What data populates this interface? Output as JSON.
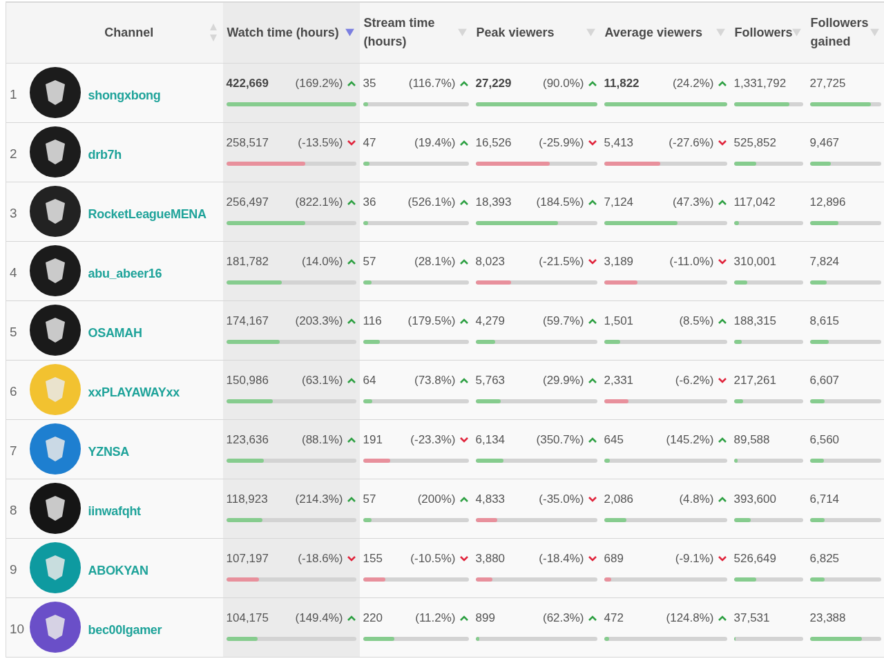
{
  "columns": [
    {
      "label": "Channel",
      "kind": "both",
      "selected": false
    },
    {
      "label": "Watch time (hours)",
      "kind": "desc",
      "selected": true
    },
    {
      "label": "Stream time (hours)",
      "kind": "desc",
      "selected": false
    },
    {
      "label": "Peak viewers",
      "kind": "desc",
      "selected": false
    },
    {
      "label": "Average viewers",
      "kind": "desc",
      "selected": false
    },
    {
      "label": "Followers",
      "kind": "desc",
      "selected": false
    },
    {
      "label": "Followers gained",
      "kind": "desc",
      "selected": false
    }
  ],
  "rows": [
    {
      "rank": "1",
      "name": "shongxbong",
      "color": "#1c1c1c",
      "metrics": [
        {
          "value": "422,669",
          "change": "(169.2%)",
          "rising": true,
          "bold": true,
          "level": 1
        },
        {
          "value": "35",
          "change": "(116.7%)",
          "rising": true,
          "bold": false,
          "level": 0.05
        },
        {
          "value": "27,229",
          "change": "(90.0%)",
          "rising": true,
          "bold": true,
          "level": 1
        },
        {
          "value": "11,822",
          "change": "(24.2%)",
          "rising": true,
          "bold": true,
          "level": 1
        },
        {
          "value": "1,331,792",
          "level": 0.8
        },
        {
          "value": "27,725",
          "level": 0.86
        }
      ]
    },
    {
      "rank": "2",
      "name": "drb7h",
      "color": "#1c1c1c",
      "metrics": [
        {
          "value": "258,517",
          "change": "(-13.5%)",
          "rising": false,
          "bold": false,
          "level": 0.61
        },
        {
          "value": "47",
          "change": "(19.4%)",
          "rising": true,
          "bold": false,
          "level": 0.06
        },
        {
          "value": "16,526",
          "change": "(-25.9%)",
          "rising": false,
          "bold": false,
          "level": 0.61
        },
        {
          "value": "5,413",
          "change": "(-27.6%)",
          "rising": false,
          "bold": false,
          "level": 0.46
        },
        {
          "value": "525,852",
          "level": 0.32
        },
        {
          "value": "9,467",
          "level": 0.3
        }
      ]
    },
    {
      "rank": "3",
      "name": "RocketLeagueMENA",
      "color": "#222222",
      "metrics": [
        {
          "value": "256,497",
          "change": "(822.1%)",
          "rising": true,
          "bold": false,
          "level": 0.61
        },
        {
          "value": "36",
          "change": "(526.1%)",
          "rising": true,
          "bold": false,
          "level": 0.05
        },
        {
          "value": "18,393",
          "change": "(184.5%)",
          "rising": true,
          "bold": false,
          "level": 0.68
        },
        {
          "value": "7,124",
          "change": "(47.3%)",
          "rising": true,
          "bold": false,
          "level": 0.6
        },
        {
          "value": "117,042",
          "level": 0.07
        },
        {
          "value": "12,896",
          "level": 0.4
        }
      ]
    },
    {
      "rank": "4",
      "name": "abu_abeer16",
      "color": "#1b1b1b",
      "metrics": [
        {
          "value": "181,782",
          "change": "(14.0%)",
          "rising": true,
          "bold": false,
          "level": 0.43
        },
        {
          "value": "57",
          "change": "(28.1%)",
          "rising": true,
          "bold": false,
          "level": 0.08
        },
        {
          "value": "8,023",
          "change": "(-21.5%)",
          "rising": false,
          "bold": false,
          "level": 0.29
        },
        {
          "value": "3,189",
          "change": "(-11.0%)",
          "rising": false,
          "bold": false,
          "level": 0.27
        },
        {
          "value": "310,001",
          "level": 0.19
        },
        {
          "value": "7,824",
          "level": 0.24
        }
      ]
    },
    {
      "rank": "5",
      "name": "OSAMAH",
      "color": "#1a1a1a",
      "metrics": [
        {
          "value": "174,167",
          "change": "(203.3%)",
          "rising": true,
          "bold": false,
          "level": 0.41
        },
        {
          "value": "116",
          "change": "(179.5%)",
          "rising": true,
          "bold": false,
          "level": 0.16
        },
        {
          "value": "4,279",
          "change": "(59.7%)",
          "rising": true,
          "bold": false,
          "level": 0.16
        },
        {
          "value": "1,501",
          "change": "(8.5%)",
          "rising": true,
          "bold": false,
          "level": 0.13
        },
        {
          "value": "188,315",
          "level": 0.11
        },
        {
          "value": "8,615",
          "level": 0.27
        }
      ]
    },
    {
      "rank": "6",
      "name": "xxPLAYAWAYxx",
      "color": "#f2c230",
      "metrics": [
        {
          "value": "150,986",
          "change": "(63.1%)",
          "rising": true,
          "bold": false,
          "level": 0.36
        },
        {
          "value": "64",
          "change": "(73.8%)",
          "rising": true,
          "bold": false,
          "level": 0.09
        },
        {
          "value": "5,763",
          "change": "(29.9%)",
          "rising": true,
          "bold": false,
          "level": 0.21
        },
        {
          "value": "2,331",
          "change": "(-6.2%)",
          "rising": false,
          "bold": false,
          "level": 0.2
        },
        {
          "value": "217,261",
          "level": 0.13
        },
        {
          "value": "6,607",
          "level": 0.21
        }
      ]
    },
    {
      "rank": "7",
      "name": "YZNSA",
      "color": "#1e7fd0",
      "metrics": [
        {
          "value": "123,636",
          "change": "(88.1%)",
          "rising": true,
          "bold": false,
          "level": 0.29
        },
        {
          "value": "191",
          "change": "(-23.3%)",
          "rising": false,
          "bold": false,
          "level": 0.26
        },
        {
          "value": "6,134",
          "change": "(350.7%)",
          "rising": true,
          "bold": false,
          "level": 0.23
        },
        {
          "value": "645",
          "change": "(145.2%)",
          "rising": true,
          "bold": false,
          "level": 0.05
        },
        {
          "value": "89,588",
          "level": 0.05
        },
        {
          "value": "6,560",
          "level": 0.2
        }
      ]
    },
    {
      "rank": "8",
      "name": "iinwafqht",
      "color": "#151515",
      "metrics": [
        {
          "value": "118,923",
          "change": "(214.3%)",
          "rising": true,
          "bold": false,
          "level": 0.28
        },
        {
          "value": "57",
          "change": "(200%)",
          "rising": true,
          "bold": false,
          "level": 0.08
        },
        {
          "value": "4,833",
          "change": "(-35.0%)",
          "rising": false,
          "bold": false,
          "level": 0.18
        },
        {
          "value": "2,086",
          "change": "(4.8%)",
          "rising": true,
          "bold": false,
          "level": 0.18
        },
        {
          "value": "393,600",
          "level": 0.24
        },
        {
          "value": "6,714",
          "level": 0.21
        }
      ]
    },
    {
      "rank": "9",
      "name": "ABOKYAN",
      "color": "#0e9aa0",
      "metrics": [
        {
          "value": "107,197",
          "change": "(-18.6%)",
          "rising": false,
          "bold": false,
          "level": 0.25
        },
        {
          "value": "155",
          "change": "(-10.5%)",
          "rising": false,
          "bold": false,
          "level": 0.21
        },
        {
          "value": "3,880",
          "change": "(-18.4%)",
          "rising": false,
          "bold": false,
          "level": 0.14
        },
        {
          "value": "689",
          "change": "(-9.1%)",
          "rising": false,
          "bold": false,
          "level": 0.06
        },
        {
          "value": "526,649",
          "level": 0.32
        },
        {
          "value": "6,825",
          "level": 0.21
        }
      ]
    },
    {
      "rank": "10",
      "name": "bec00lgamer",
      "color": "#6a4fc8",
      "metrics": [
        {
          "value": "104,175",
          "change": "(149.4%)",
          "rising": true,
          "bold": false,
          "level": 0.24
        },
        {
          "value": "220",
          "change": "(11.2%)",
          "rising": true,
          "bold": false,
          "level": 0.3
        },
        {
          "value": "899",
          "change": "(62.3%)",
          "rising": true,
          "bold": false,
          "level": 0.03
        },
        {
          "value": "472",
          "change": "(124.8%)",
          "rising": true,
          "bold": false,
          "level": 0.04
        },
        {
          "value": "37,531",
          "level": 0.02
        },
        {
          "value": "23,388",
          "level": 0.73
        }
      ]
    }
  ]
}
